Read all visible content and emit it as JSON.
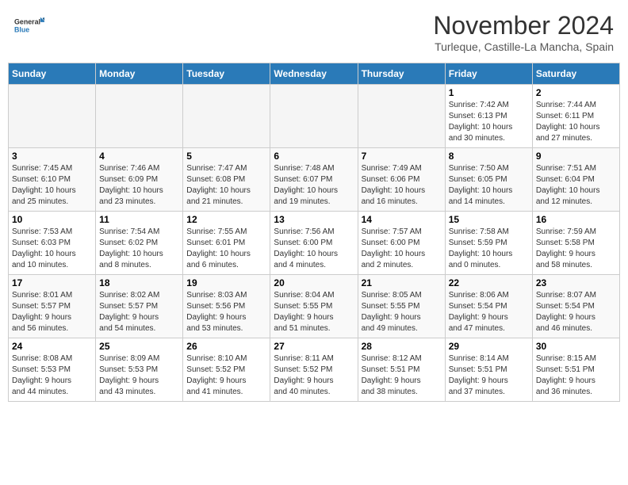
{
  "header": {
    "logo_line1": "General",
    "logo_line2": "Blue",
    "month_title": "November 2024",
    "location": "Turleque, Castille-La Mancha, Spain"
  },
  "weekdays": [
    "Sunday",
    "Monday",
    "Tuesday",
    "Wednesday",
    "Thursday",
    "Friday",
    "Saturday"
  ],
  "weeks": [
    [
      {
        "day": "",
        "info": ""
      },
      {
        "day": "",
        "info": ""
      },
      {
        "day": "",
        "info": ""
      },
      {
        "day": "",
        "info": ""
      },
      {
        "day": "",
        "info": ""
      },
      {
        "day": "1",
        "info": "Sunrise: 7:42 AM\nSunset: 6:13 PM\nDaylight: 10 hours\nand 30 minutes."
      },
      {
        "day": "2",
        "info": "Sunrise: 7:44 AM\nSunset: 6:11 PM\nDaylight: 10 hours\nand 27 minutes."
      }
    ],
    [
      {
        "day": "3",
        "info": "Sunrise: 7:45 AM\nSunset: 6:10 PM\nDaylight: 10 hours\nand 25 minutes."
      },
      {
        "day": "4",
        "info": "Sunrise: 7:46 AM\nSunset: 6:09 PM\nDaylight: 10 hours\nand 23 minutes."
      },
      {
        "day": "5",
        "info": "Sunrise: 7:47 AM\nSunset: 6:08 PM\nDaylight: 10 hours\nand 21 minutes."
      },
      {
        "day": "6",
        "info": "Sunrise: 7:48 AM\nSunset: 6:07 PM\nDaylight: 10 hours\nand 19 minutes."
      },
      {
        "day": "7",
        "info": "Sunrise: 7:49 AM\nSunset: 6:06 PM\nDaylight: 10 hours\nand 16 minutes."
      },
      {
        "day": "8",
        "info": "Sunrise: 7:50 AM\nSunset: 6:05 PM\nDaylight: 10 hours\nand 14 minutes."
      },
      {
        "day": "9",
        "info": "Sunrise: 7:51 AM\nSunset: 6:04 PM\nDaylight: 10 hours\nand 12 minutes."
      }
    ],
    [
      {
        "day": "10",
        "info": "Sunrise: 7:53 AM\nSunset: 6:03 PM\nDaylight: 10 hours\nand 10 minutes."
      },
      {
        "day": "11",
        "info": "Sunrise: 7:54 AM\nSunset: 6:02 PM\nDaylight: 10 hours\nand 8 minutes."
      },
      {
        "day": "12",
        "info": "Sunrise: 7:55 AM\nSunset: 6:01 PM\nDaylight: 10 hours\nand 6 minutes."
      },
      {
        "day": "13",
        "info": "Sunrise: 7:56 AM\nSunset: 6:00 PM\nDaylight: 10 hours\nand 4 minutes."
      },
      {
        "day": "14",
        "info": "Sunrise: 7:57 AM\nSunset: 6:00 PM\nDaylight: 10 hours\nand 2 minutes."
      },
      {
        "day": "15",
        "info": "Sunrise: 7:58 AM\nSunset: 5:59 PM\nDaylight: 10 hours\nand 0 minutes."
      },
      {
        "day": "16",
        "info": "Sunrise: 7:59 AM\nSunset: 5:58 PM\nDaylight: 9 hours\nand 58 minutes."
      }
    ],
    [
      {
        "day": "17",
        "info": "Sunrise: 8:01 AM\nSunset: 5:57 PM\nDaylight: 9 hours\nand 56 minutes."
      },
      {
        "day": "18",
        "info": "Sunrise: 8:02 AM\nSunset: 5:57 PM\nDaylight: 9 hours\nand 54 minutes."
      },
      {
        "day": "19",
        "info": "Sunrise: 8:03 AM\nSunset: 5:56 PM\nDaylight: 9 hours\nand 53 minutes."
      },
      {
        "day": "20",
        "info": "Sunrise: 8:04 AM\nSunset: 5:55 PM\nDaylight: 9 hours\nand 51 minutes."
      },
      {
        "day": "21",
        "info": "Sunrise: 8:05 AM\nSunset: 5:55 PM\nDaylight: 9 hours\nand 49 minutes."
      },
      {
        "day": "22",
        "info": "Sunrise: 8:06 AM\nSunset: 5:54 PM\nDaylight: 9 hours\nand 47 minutes."
      },
      {
        "day": "23",
        "info": "Sunrise: 8:07 AM\nSunset: 5:54 PM\nDaylight: 9 hours\nand 46 minutes."
      }
    ],
    [
      {
        "day": "24",
        "info": "Sunrise: 8:08 AM\nSunset: 5:53 PM\nDaylight: 9 hours\nand 44 minutes."
      },
      {
        "day": "25",
        "info": "Sunrise: 8:09 AM\nSunset: 5:53 PM\nDaylight: 9 hours\nand 43 minutes."
      },
      {
        "day": "26",
        "info": "Sunrise: 8:10 AM\nSunset: 5:52 PM\nDaylight: 9 hours\nand 41 minutes."
      },
      {
        "day": "27",
        "info": "Sunrise: 8:11 AM\nSunset: 5:52 PM\nDaylight: 9 hours\nand 40 minutes."
      },
      {
        "day": "28",
        "info": "Sunrise: 8:12 AM\nSunset: 5:51 PM\nDaylight: 9 hours\nand 38 minutes."
      },
      {
        "day": "29",
        "info": "Sunrise: 8:14 AM\nSunset: 5:51 PM\nDaylight: 9 hours\nand 37 minutes."
      },
      {
        "day": "30",
        "info": "Sunrise: 8:15 AM\nSunset: 5:51 PM\nDaylight: 9 hours\nand 36 minutes."
      }
    ]
  ]
}
